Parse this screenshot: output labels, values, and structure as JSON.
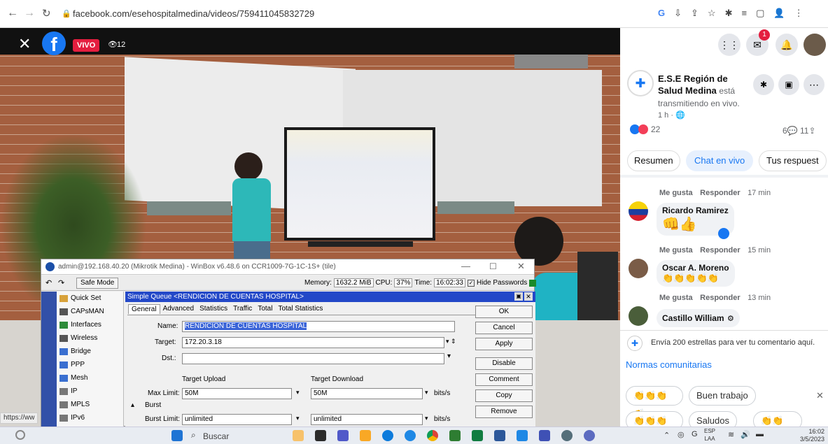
{
  "browser": {
    "url": "facebook.com/esehospitalmedina/videos/759411045832729",
    "ext_icons": [
      "G",
      "⇩",
      "⇪",
      "☆",
      "✱",
      "≡",
      "▢",
      "👤",
      "⋮"
    ]
  },
  "video": {
    "live_badge": "VIVO",
    "viewers": "12",
    "status_url": "https://ww"
  },
  "winbox": {
    "title": "admin@192.168.40.20 (Mikrotik Medina) - WinBox v6.48.6 on CCR1009-7G-1C-1S+ (tile)",
    "safe_mode": "Safe Mode",
    "memory": "1632.2 MiB",
    "cpu": "37%",
    "time": "16:02:33",
    "hide_passwords": "Hide Passwords",
    "memory_label": "Memory:",
    "cpu_label": "CPU:",
    "time_label": "Time:",
    "menu": [
      "Quick Set",
      "CAPsMAN",
      "Interfaces",
      "Wireless",
      "Bridge",
      "PPP",
      "Mesh",
      "IP",
      "MPLS",
      "IPv6"
    ],
    "dialog_title": "Simple Queue <RENDICION DE CUENTAS HOSPITAL>",
    "tabs": [
      "General",
      "Advanced",
      "Statistics",
      "Traffic",
      "Total",
      "Total Statistics"
    ],
    "name_label": "Name:",
    "name_value": "RENDICION DE CUENTAS HOSPITAL",
    "target_label": "Target:",
    "target_value": "172.20.3.18",
    "dst_label": "Dst.:",
    "target_upload": "Target Upload",
    "target_download": "Target Download",
    "max_limit_label": "Max Limit:",
    "max_up": "50M",
    "max_down": "50M",
    "bits_unit": "bits/s",
    "burst_label": "Burst",
    "burst_limit_label": "Burst Limit:",
    "burst_up": "unlimited",
    "burst_down": "unlimited",
    "buttons": [
      "OK",
      "Cancel",
      "Apply",
      "Disable",
      "Comment",
      "Copy",
      "Remove"
    ]
  },
  "fb": {
    "page_name": "E.S.E Región de Salud Medina",
    "page_action": "está transmitiendo en vivo.",
    "post_time": "1 h · ",
    "reactions": "22",
    "comments_count": "6",
    "shares_count": "11",
    "tab_summary": "Resumen",
    "tab_live_chat": "Chat en vivo",
    "tab_responses": "Tus respuest",
    "like_label": "Me gusta",
    "reply_label": "Responder",
    "comments": [
      {
        "name": "",
        "emojis": "",
        "time": "17 min"
      },
      {
        "name": "Ricardo Ramirez",
        "emojis": "👊👍",
        "time": "15 min"
      },
      {
        "name": "Oscar A. Moreno",
        "emojis": "👏👏👏👏👏",
        "time": "13 min"
      },
      {
        "name": "Castillo William",
        "emojis": "",
        "time": ""
      }
    ],
    "stars_text": "Envía 200 estrellas para ver tu comentario aquí.",
    "community": "Normas comunitarias",
    "quick_replies": [
      "Buen trabajo",
      "Saludos"
    ],
    "notif_count": "1"
  },
  "taskbar": {
    "search": "Buscar",
    "lang": "ESP",
    "lang2": "LAA",
    "time": "16:02",
    "date": "3/5/2023"
  },
  "colors": {
    "fb_blue": "#1877f2",
    "live_red": "#e41e3f",
    "winbox_title": "#1f3fbf"
  }
}
